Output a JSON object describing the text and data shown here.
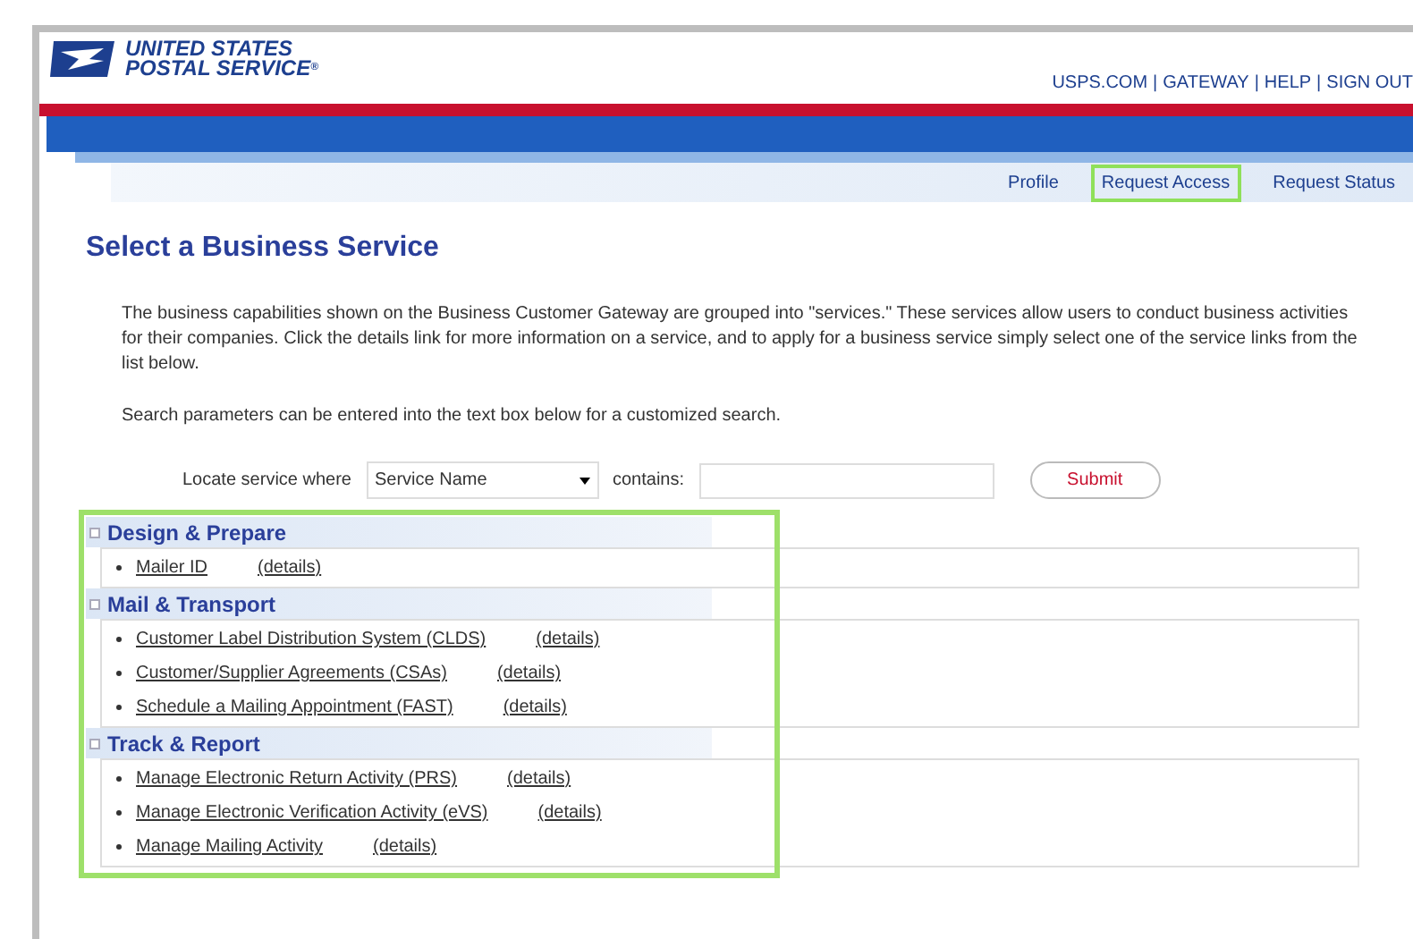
{
  "header": {
    "logo_line1": "UNITED STATES",
    "logo_line2": "POSTAL SERVICE",
    "logo_mark": "®",
    "links": [
      "USPS.COM",
      "GATEWAY",
      "HELP",
      "SIGN OUT"
    ],
    "separator": "|"
  },
  "tabs": [
    {
      "label": "Profile",
      "selected": false
    },
    {
      "label": "Request Access",
      "selected": true
    },
    {
      "label": "Request Status",
      "selected": false
    }
  ],
  "page_title": "Select a Business Service",
  "intro": "The business capabilities shown on the Business Customer Gateway are grouped into \"services.\" These services allow users to conduct business activities for their companies. Click the details link for more information on a service, and to apply for a business service simply select one of the service links from the list below.",
  "search_hint": "Search parameters can be entered into the text box below for a customized search.",
  "search": {
    "label": "Locate service where",
    "field": "Service Name",
    "contains_label": "contains:",
    "button": "Submit"
  },
  "groups": [
    {
      "title": "Design & Prepare",
      "expanded": true,
      "services": [
        {
          "name": "Mailer ID",
          "details": "(details)"
        }
      ]
    },
    {
      "title": "Mail & Transport",
      "expanded": true,
      "services": [
        {
          "name": "Customer Label Distribution System (CLDS)",
          "details": "(details)"
        },
        {
          "name": "Customer/Supplier Agreements (CSAs)",
          "details": "(details)"
        },
        {
          "name": "Schedule a Mailing Appointment (FAST)",
          "details": "(details)"
        }
      ]
    },
    {
      "title": "Track & Report",
      "expanded": true,
      "services": [
        {
          "name": "Manage Electronic Return Activity (PRS)",
          "details": "(details)"
        },
        {
          "name": "Manage Electronic Verification Activity (eVS)",
          "details": "(details)"
        },
        {
          "name": "Manage Mailing Activity",
          "details": "(details)"
        }
      ]
    }
  ]
}
